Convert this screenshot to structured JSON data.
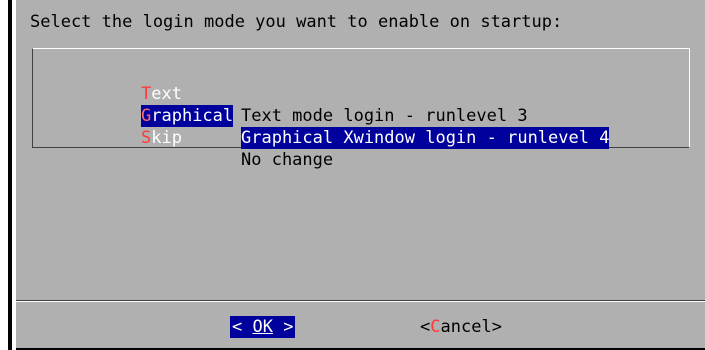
{
  "dialog": {
    "prompt": "Select the login mode you want to enable on startup:",
    "options": [
      {
        "tag_hot": "T",
        "tag_rest": "ext",
        "description": "Text mode login - runlevel 3",
        "selected": false
      },
      {
        "tag_hot": "G",
        "tag_rest": "raphical",
        "description": "Graphical Xwindow login - runlevel 4",
        "selected": true
      },
      {
        "tag_hot": "S",
        "tag_rest": "kip",
        "description": "No change",
        "selected": false
      }
    ],
    "buttons": {
      "ok": {
        "left": "< ",
        "label": "OK",
        "right": " >"
      },
      "cancel": {
        "open": "<",
        "hot": "C",
        "rest": "ancel",
        "close": ">"
      }
    }
  },
  "colors": {
    "dialog_bg": "#b0b0b0",
    "selection_bg": "#00009c",
    "hotkey": "#ff3a3a",
    "tag_text": "#ffffff"
  }
}
